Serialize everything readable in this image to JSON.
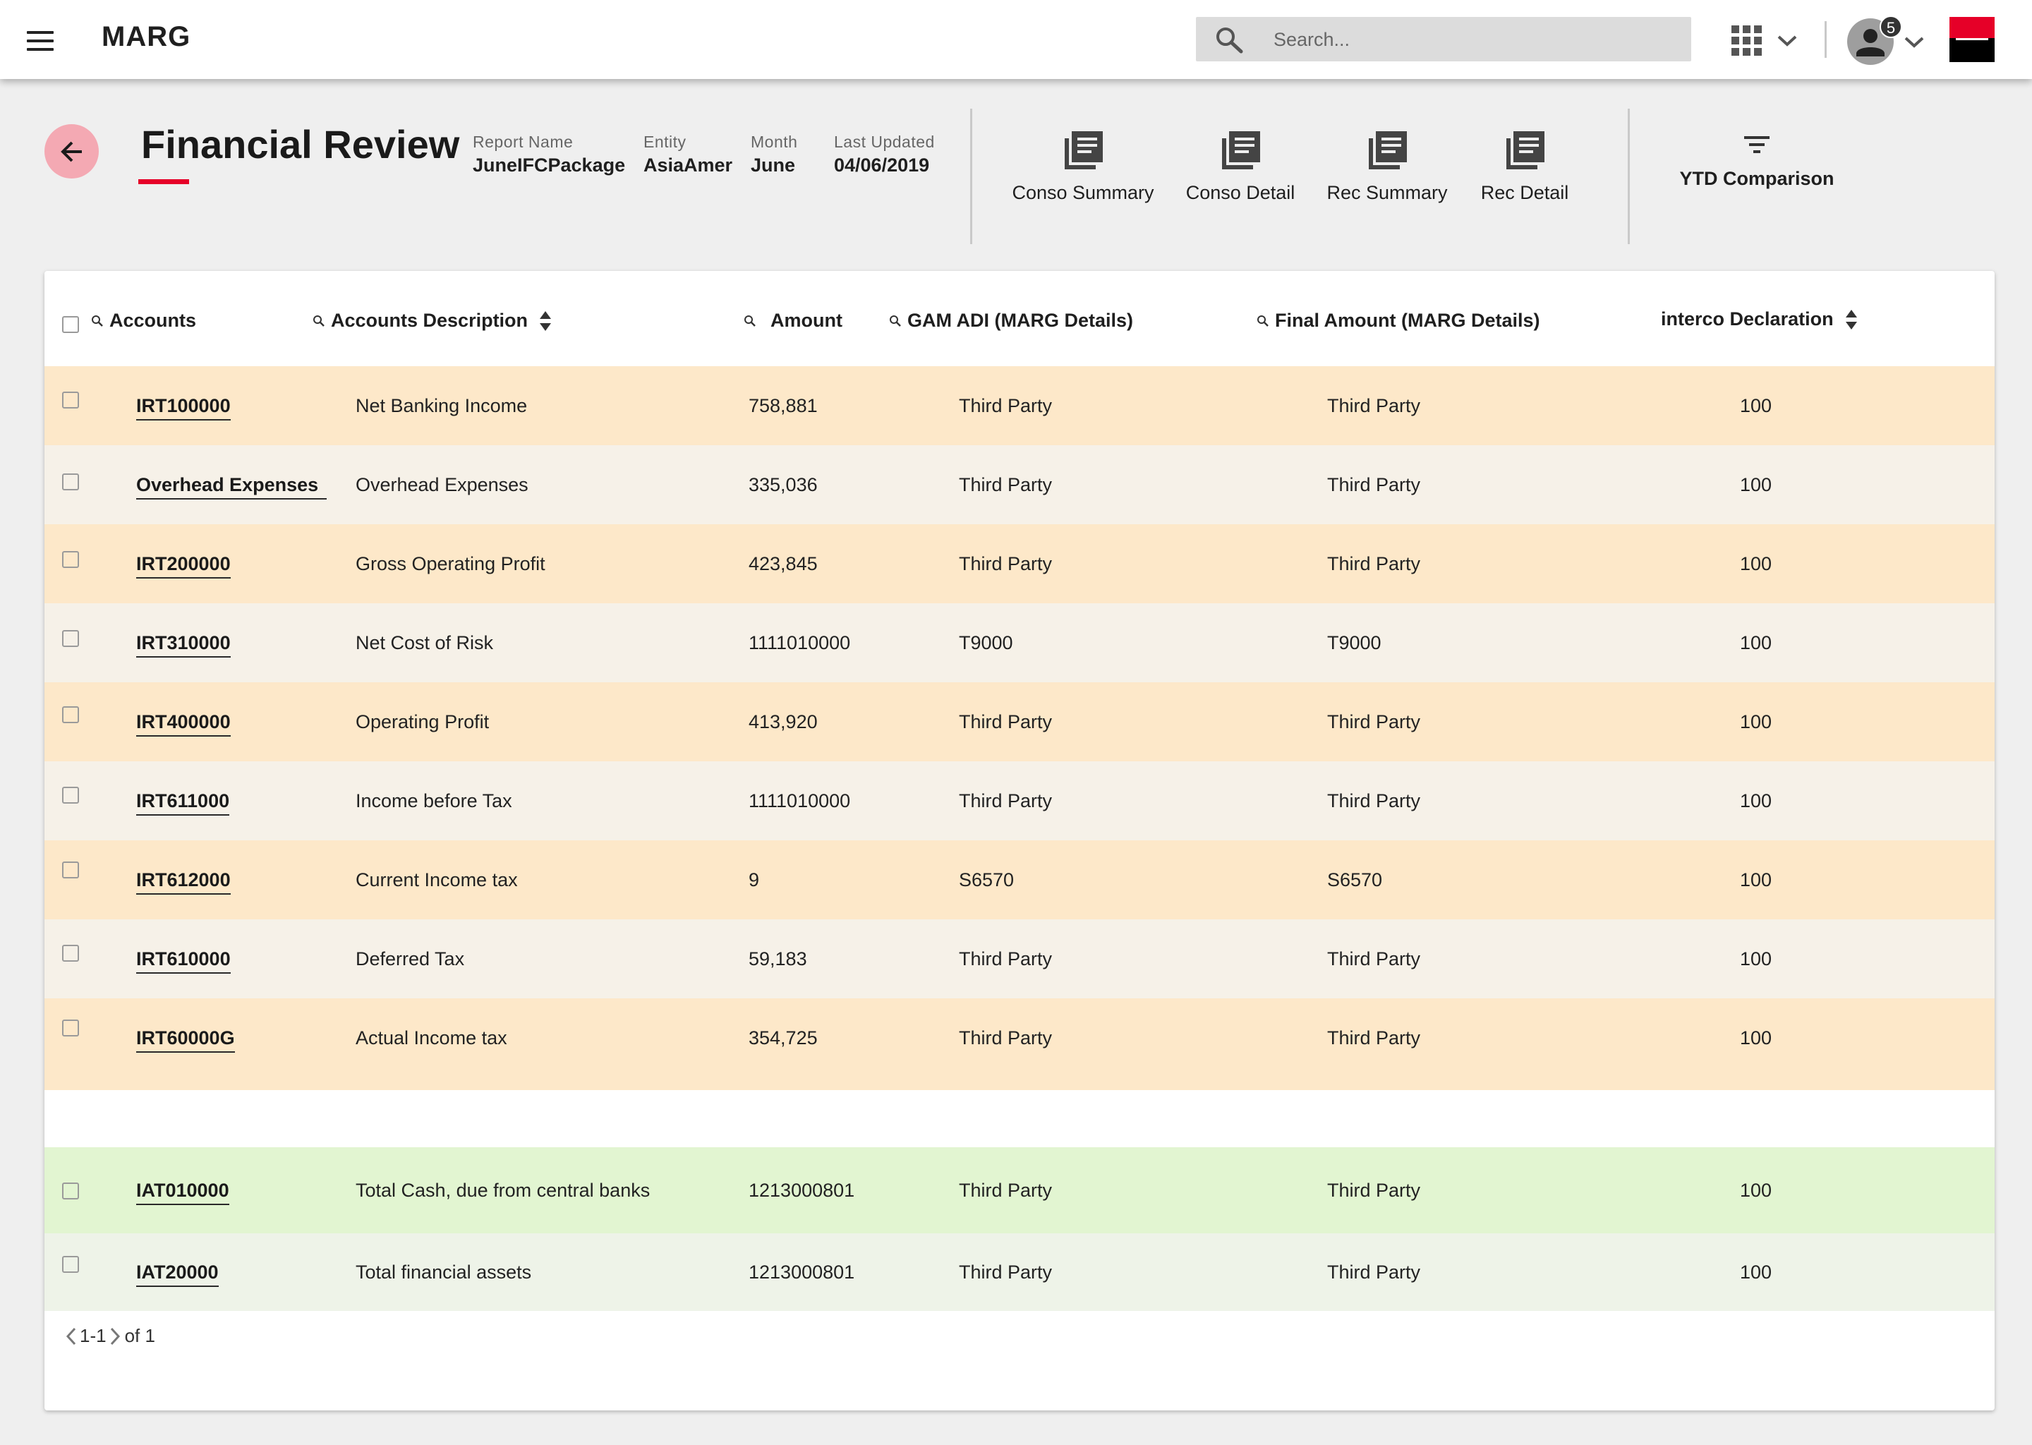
{
  "topbar": {
    "brand": "MARG",
    "search_placeholder": "Search...",
    "notification_count": "5"
  },
  "header": {
    "title": "Financial Review",
    "meta": [
      {
        "label": "Report Name",
        "value": "JuneIFCPackage"
      },
      {
        "label": "Entity",
        "value": "AsiaAmer"
      },
      {
        "label": "Month",
        "value": "June"
      },
      {
        "label": "Last Updated",
        "value": "04/06/2019"
      }
    ],
    "reports": [
      "Conso Summary",
      "Conso Detail",
      "Rec Summary",
      "Rec Detail"
    ],
    "ytd_label": "YTD Comparison"
  },
  "table": {
    "columns": [
      "Accounts",
      "Accounts Description",
      "Amount",
      "GAM ADI (MARG Details)",
      "Final Amount (MARG Details)",
      "interco Declaration"
    ],
    "rows": [
      {
        "account": "IRT100000",
        "description": "Net Banking Income",
        "amount": "758,881",
        "gam": "Third Party",
        "final": "Third Party",
        "interco": "100"
      },
      {
        "account": "Overhead Expenses",
        "description": "Overhead Expenses",
        "amount": "335,036",
        "gam": "Third Party",
        "final": "Third Party",
        "interco": "100"
      },
      {
        "account": "IRT200000",
        "description": "Gross Operating Profit",
        "amount": "423,845",
        "gam": "Third Party",
        "final": "Third Party",
        "interco": "100"
      },
      {
        "account": "IRT310000",
        "description": "Net Cost of Risk",
        "amount": "1111010000",
        "gam": "T9000",
        "final": "T9000",
        "interco": "100"
      },
      {
        "account": "IRT400000",
        "description": "Operating Profit",
        "amount": "413,920",
        "gam": "Third Party",
        "final": "Third Party",
        "interco": "100"
      },
      {
        "account": "IRT611000",
        "description": "Income before Tax",
        "amount": "1111010000",
        "gam": "Third Party",
        "final": "Third Party",
        "interco": "100"
      },
      {
        "account": "IRT612000",
        "description": "Current Income tax",
        "amount": "9",
        "gam": "S6570",
        "final": "S6570",
        "interco": "100"
      },
      {
        "account": "IRT610000",
        "description": "Deferred Tax",
        "amount": "59,183",
        "gam": "Third Party",
        "final": "Third Party",
        "interco": "100"
      },
      {
        "account": "IRT60000G",
        "description": "Actual Income tax",
        "amount": "354,725",
        "gam": "Third Party",
        "final": "Third Party",
        "interco": "100"
      },
      {
        "account": "IAT010000",
        "description": "Total Cash, due from central banks",
        "amount": "1213000801",
        "gam": "Third Party",
        "final": "Third Party",
        "interco": "100"
      },
      {
        "account": "IAT20000",
        "description": "Total financial assets",
        "amount": "1213000801",
        "gam": "Third Party",
        "final": "Third Party",
        "interco": "100"
      }
    ]
  },
  "pagination": {
    "range": "1-1",
    "total": "of 1"
  },
  "colors": {
    "accent_red": "#e60028",
    "back_button": "#f4a9b3",
    "row_orange": "#fde8c9",
    "row_cream": "#f6f1e8",
    "row_green": "#e2f5d1",
    "row_light_green": "#eef3e8"
  }
}
